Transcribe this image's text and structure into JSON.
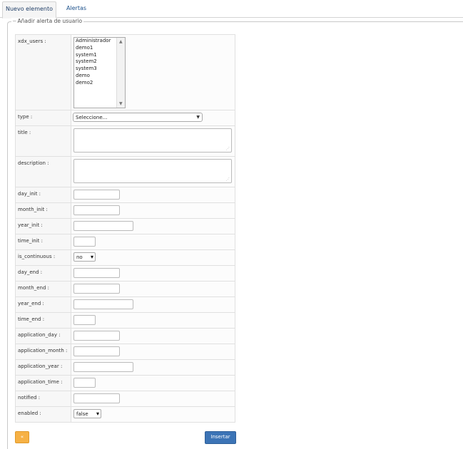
{
  "tabs": [
    {
      "label": "Nuevo elemento",
      "active": true
    },
    {
      "label": "Alertas",
      "active": false
    }
  ],
  "fieldset": {
    "legend": "Añadir alerta de usuario"
  },
  "form": {
    "xdx_users": {
      "label": "xdx_users :",
      "options": [
        "Administrador",
        "demo1",
        "system1",
        "system2",
        "system3",
        "demo",
        "demo2"
      ]
    },
    "type": {
      "label": "type :",
      "value": "Seleccione..."
    },
    "title": {
      "label": "title :",
      "value": ""
    },
    "description": {
      "label": "description :",
      "value": ""
    },
    "day_init": {
      "label": "day_init :",
      "value": ""
    },
    "month_init": {
      "label": "month_init :",
      "value": ""
    },
    "year_init": {
      "label": "year_init :",
      "value": ""
    },
    "time_init": {
      "label": "time_init :",
      "value": ""
    },
    "is_continuous": {
      "label": "is_continuous :",
      "value": "no"
    },
    "day_end": {
      "label": "day_end :",
      "value": ""
    },
    "month_end": {
      "label": "month_end :",
      "value": ""
    },
    "year_end": {
      "label": "year_end :",
      "value": ""
    },
    "time_end": {
      "label": "time_end :",
      "value": ""
    },
    "application_day": {
      "label": "application_day :",
      "value": ""
    },
    "application_month": {
      "label": "application_month :",
      "value": ""
    },
    "application_year": {
      "label": "application_year :",
      "value": ""
    },
    "application_time": {
      "label": "application_time :",
      "value": ""
    },
    "notified": {
      "label": "notified :",
      "value": ""
    },
    "enabled": {
      "label": "enabled :",
      "value": "false"
    }
  },
  "buttons": {
    "small": "«",
    "insert": "Insertar"
  },
  "colors": {
    "accent": "#3c74b6",
    "warning": "#f6b145",
    "tab_text": "#1a4f8a"
  },
  "icons": {
    "listbox_scroll": "scroll-arrows",
    "select": "chevron-down-icon"
  }
}
